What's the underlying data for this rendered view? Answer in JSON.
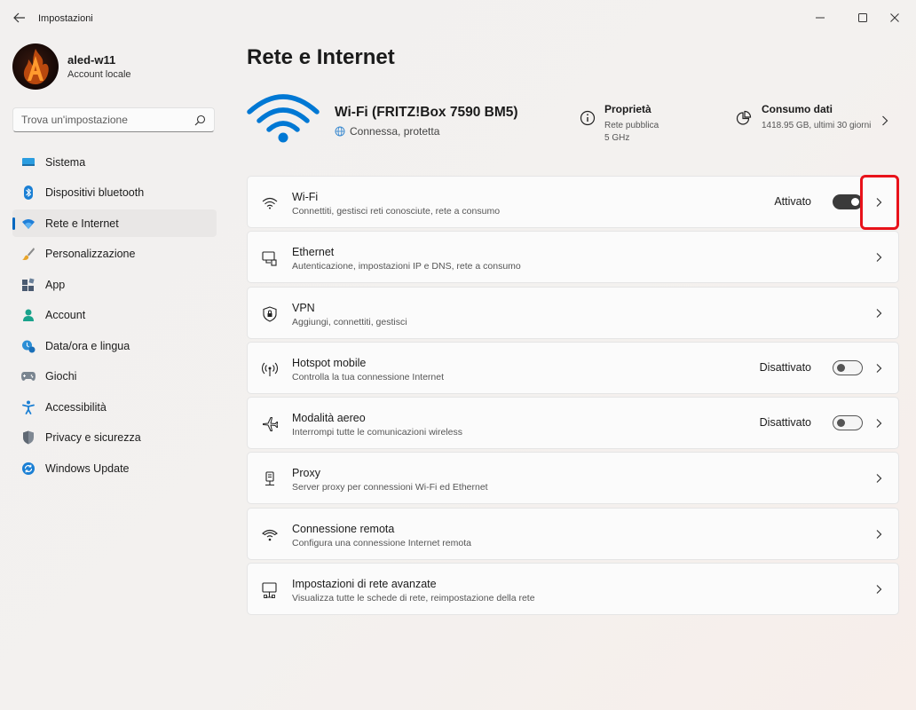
{
  "window": {
    "title": "Impostazioni"
  },
  "profile": {
    "name": "aled-w11",
    "account_type": "Account locale"
  },
  "search": {
    "placeholder": "Trova un'impostazione"
  },
  "nav": {
    "items": [
      {
        "label": "Sistema",
        "icon": "monitor-icon"
      },
      {
        "label": "Dispositivi bluetooth",
        "icon": "bluetooth-icon"
      },
      {
        "label": "Rete e Internet",
        "icon": "wifi-icon",
        "active": true
      },
      {
        "label": "Personalizzazione",
        "icon": "brush-icon"
      },
      {
        "label": "App",
        "icon": "apps-icon"
      },
      {
        "label": "Account",
        "icon": "person-icon"
      },
      {
        "label": "Data/ora e lingua",
        "icon": "clock-globe-icon"
      },
      {
        "label": "Giochi",
        "icon": "gamepad-icon"
      },
      {
        "label": "Accessibilità",
        "icon": "accessibility-icon"
      },
      {
        "label": "Privacy e sicurezza",
        "icon": "shield-icon"
      },
      {
        "label": "Windows Update",
        "icon": "update-icon"
      }
    ]
  },
  "page": {
    "title": "Rete e Internet"
  },
  "hero": {
    "network_name": "Wi-Fi (FRITZ!Box 7590 BM5)",
    "status": "Connessa, protetta",
    "properties": {
      "title": "Proprietà",
      "line1": "Rete pubblica",
      "line2": "5 GHz"
    },
    "data_usage": {
      "title": "Consumo dati",
      "detail": "1418.95 GB, ultimi 30 giorni"
    }
  },
  "cards": [
    {
      "title": "Wi-Fi",
      "desc": "Connettiti, gestisci reti conosciute, rete a consumo",
      "state": "Attivato",
      "toggle": "on",
      "icon": "wifi-icon"
    },
    {
      "title": "Ethernet",
      "desc": "Autenticazione, impostazioni IP e DNS, rete a consumo",
      "icon": "ethernet-icon"
    },
    {
      "title": "VPN",
      "desc": "Aggiungi, connettiti, gestisci",
      "icon": "vpn-shield-icon"
    },
    {
      "title": "Hotspot mobile",
      "desc": "Controlla la tua connessione Internet",
      "state": "Disattivato",
      "toggle": "off",
      "icon": "hotspot-icon"
    },
    {
      "title": "Modalità aereo",
      "desc": "Interrompi tutte le comunicazioni wireless",
      "state": "Disattivato",
      "toggle": "off",
      "icon": "airplane-icon"
    },
    {
      "title": "Proxy",
      "desc": "Server proxy per connessioni Wi-Fi ed Ethernet",
      "icon": "proxy-icon"
    },
    {
      "title": "Connessione remota",
      "desc": "Configura una connessione Internet remota",
      "icon": "dialup-icon"
    },
    {
      "title": "Impostazioni di rete avanzate",
      "desc": "Visualizza tutte le schede di rete, reimpostazione della rete",
      "icon": "network-pc-icon"
    }
  ],
  "colors": {
    "accent": "#0067c0",
    "highlight": "#e8121a",
    "wifi_hero": "#0078d4"
  }
}
